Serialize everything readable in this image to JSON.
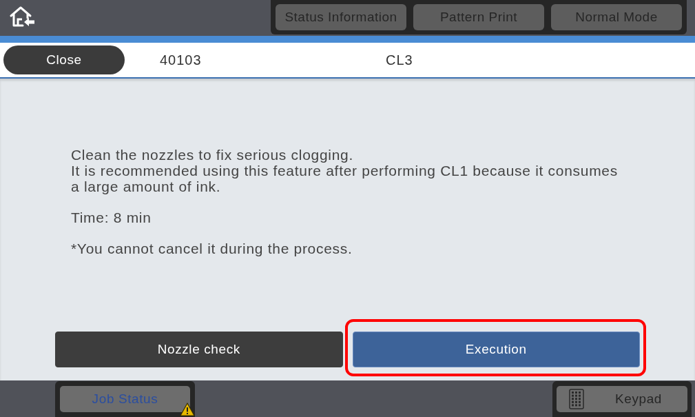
{
  "top_bar": {
    "buttons": [
      "Status Information",
      "Pattern Print",
      "Normal Mode"
    ]
  },
  "header": {
    "close_label": "Close",
    "number": "40103",
    "title": "CL3"
  },
  "message": {
    "paragraphs": [
      [
        "Clean the nozzles to fix serious clogging.",
        "It is recommended using this feature after performing CL1 because it consumes a large amount of ink."
      ],
      [
        "Time: 8 min"
      ],
      [
        "*You cannot cancel it during the process."
      ]
    ]
  },
  "actions": [
    {
      "label": "Nozzle check",
      "kind": "secondary",
      "highlighted": false
    },
    {
      "label": "Execution",
      "kind": "primary",
      "highlighted": true
    }
  ],
  "bottom_bar": {
    "job_status": {
      "label": "Job Status",
      "warning": true
    },
    "keypad": {
      "label": "Keypad"
    }
  }
}
